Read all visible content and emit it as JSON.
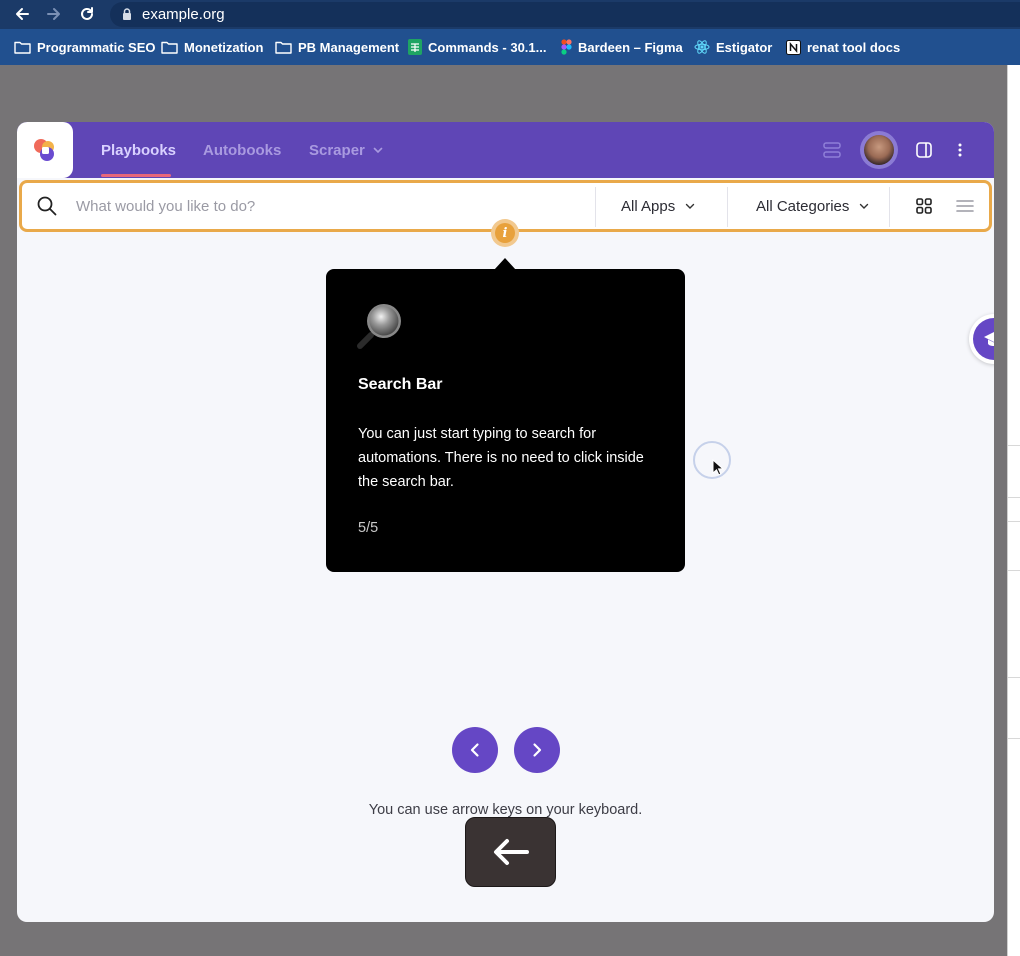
{
  "browser": {
    "url": "example.org",
    "bookmarks": [
      {
        "label": "Programmatic SEO",
        "icon": "folder-icon"
      },
      {
        "label": "Monetization",
        "icon": "folder-icon"
      },
      {
        "label": "PB Management",
        "icon": "folder-icon"
      },
      {
        "label": "Commands - 30.1...",
        "icon": "sheets-icon"
      },
      {
        "label": "Bardeen – Figma",
        "icon": "figma-icon"
      },
      {
        "label": "Estigator",
        "icon": "react-icon"
      },
      {
        "label": "renat tool docs",
        "icon": "notion-icon"
      }
    ]
  },
  "app": {
    "tabs": [
      {
        "label": "Playbooks",
        "active": true
      },
      {
        "label": "Autobooks",
        "active": false
      },
      {
        "label": "Scraper",
        "active": false
      }
    ],
    "search": {
      "placeholder": "What would you like to do?",
      "apps_filter": "All Apps",
      "categories_filter": "All Categories"
    },
    "tooltip": {
      "title": "Search Bar",
      "body": "You can just start typing to search for automations. There is no need to click inside the search bar.",
      "step": "5/5"
    },
    "hint": "You can use arrow keys on your keyboard."
  },
  "colors": {
    "header": "#5f46b6",
    "accent": "#6547c5",
    "highlight": "#e9a94a",
    "chrome": "#1b3a68",
    "bookmarks_bar": "#21508f"
  }
}
